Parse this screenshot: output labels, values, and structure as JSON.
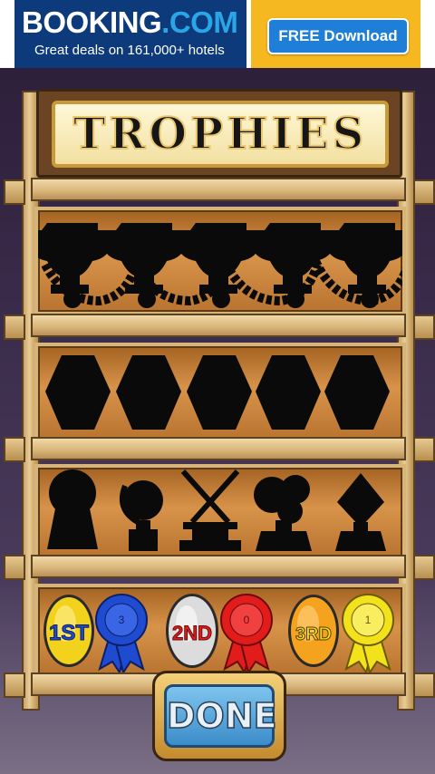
{
  "ad": {
    "brand_main": "BOOKING",
    "brand_tld": ".COM",
    "tagline": "Great deals on 161,000+ hotels",
    "cta": "FREE Download",
    "colors": {
      "left_bg": "#0d3a7a",
      "right_bg": "#f6b820",
      "button": "#1e7ed8"
    }
  },
  "screen": {
    "title": "TROPHIES",
    "done_label": "DONE"
  },
  "shelves": [
    {
      "name": "trophy-cups",
      "count": 5,
      "icon": "trophy-cup-silhouette-icon"
    },
    {
      "name": "hexagons",
      "count": 5,
      "icon": "hexagon-silhouette-icon"
    },
    {
      "name": "misc-trophies",
      "icons": [
        "keyhole-trophy-icon",
        "globe-trophy-icon",
        "crossed-swords-trophy-icon",
        "flower-trophy-icon",
        "diamond-trophy-icon"
      ]
    }
  ],
  "awards": [
    {
      "medal": "1ST",
      "medal_color": "#f2d21c",
      "ribbon_label": "3",
      "ribbon_color": "#1f4bd1"
    },
    {
      "medal": "2ND",
      "medal_color": "#dcdcdc",
      "ribbon_label": "0",
      "ribbon_color": "#e21b1b"
    },
    {
      "medal": "3RD",
      "medal_color": "#f5a21e",
      "ribbon_label": "1",
      "ribbon_color": "#f2e21c"
    }
  ]
}
